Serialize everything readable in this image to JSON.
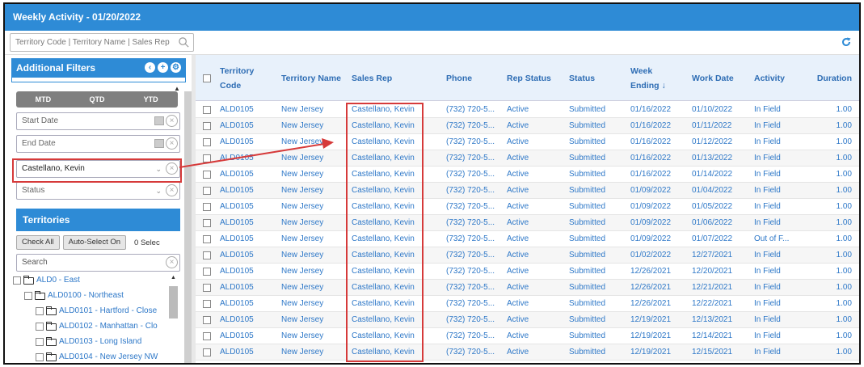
{
  "window": {
    "title": "Weekly Activity - 01/20/2022"
  },
  "toolbar": {
    "search_placeholder": "Territory Code | Territory Name | Sales Rep"
  },
  "filters": {
    "title": "Additional Filters",
    "periods": [
      "MTD",
      "QTD",
      "YTD"
    ],
    "start_date": "Start Date",
    "end_date": "End Date",
    "sales_rep": "Castellano, Kevin",
    "status": "Status"
  },
  "territories": {
    "title": "Territories",
    "check_all": "Check All",
    "auto_select": "Auto-Select On",
    "selected_text": "0 Selec",
    "search_placeholder": "Search",
    "tree": [
      {
        "label": "ALD0 - East",
        "level": 0
      },
      {
        "label": "ALD0100 - Northeast",
        "level": 1
      },
      {
        "label": "ALD0101 - Hartford - Close",
        "level": 2
      },
      {
        "label": "ALD0102 - Manhattan - Clo",
        "level": 2
      },
      {
        "label": "ALD0103 - Long Island",
        "level": 2
      },
      {
        "label": "ALD0104 - New Jersey NW",
        "level": 2
      }
    ]
  },
  "table": {
    "headers": {
      "territory_code": "Territory Code",
      "territory_name": "Territory Name",
      "sales_rep": "Sales Rep",
      "phone": "Phone",
      "rep_status": "Rep Status",
      "status": "Status",
      "week_ending": "Week Ending ↓",
      "work_date": "Work Date",
      "activity": "Activity",
      "duration": "Duration"
    },
    "rows": [
      [
        "ALD0105",
        "New Jersey",
        "Castellano, Kevin",
        "(732) 720-5...",
        "Active",
        "Submitted",
        "01/16/2022",
        "01/10/2022",
        "In Field",
        "1.00"
      ],
      [
        "ALD0105",
        "New Jersey",
        "Castellano, Kevin",
        "(732) 720-5...",
        "Active",
        "Submitted",
        "01/16/2022",
        "01/11/2022",
        "In Field",
        "1.00"
      ],
      [
        "ALD0105",
        "New Jersey",
        "Castellano, Kevin",
        "(732) 720-5...",
        "Active",
        "Submitted",
        "01/16/2022",
        "01/12/2022",
        "In Field",
        "1.00"
      ],
      [
        "ALD0105",
        "New Jersey",
        "Castellano, Kevin",
        "(732) 720-5...",
        "Active",
        "Submitted",
        "01/16/2022",
        "01/13/2022",
        "In Field",
        "1.00"
      ],
      [
        "ALD0105",
        "New Jersey",
        "Castellano, Kevin",
        "(732) 720-5...",
        "Active",
        "Submitted",
        "01/16/2022",
        "01/14/2022",
        "In Field",
        "1.00"
      ],
      [
        "ALD0105",
        "New Jersey",
        "Castellano, Kevin",
        "(732) 720-5...",
        "Active",
        "Submitted",
        "01/09/2022",
        "01/04/2022",
        "In Field",
        "1.00"
      ],
      [
        "ALD0105",
        "New Jersey",
        "Castellano, Kevin",
        "(732) 720-5...",
        "Active",
        "Submitted",
        "01/09/2022",
        "01/05/2022",
        "In Field",
        "1.00"
      ],
      [
        "ALD0105",
        "New Jersey",
        "Castellano, Kevin",
        "(732) 720-5...",
        "Active",
        "Submitted",
        "01/09/2022",
        "01/06/2022",
        "In Field",
        "1.00"
      ],
      [
        "ALD0105",
        "New Jersey",
        "Castellano, Kevin",
        "(732) 720-5...",
        "Active",
        "Submitted",
        "01/09/2022",
        "01/07/2022",
        "Out of F...",
        "1.00"
      ],
      [
        "ALD0105",
        "New Jersey",
        "Castellano, Kevin",
        "(732) 720-5...",
        "Active",
        "Submitted",
        "01/02/2022",
        "12/27/2021",
        "In Field",
        "1.00"
      ],
      [
        "ALD0105",
        "New Jersey",
        "Castellano, Kevin",
        "(732) 720-5...",
        "Active",
        "Submitted",
        "12/26/2021",
        "12/20/2021",
        "In Field",
        "1.00"
      ],
      [
        "ALD0105",
        "New Jersey",
        "Castellano, Kevin",
        "(732) 720-5...",
        "Active",
        "Submitted",
        "12/26/2021",
        "12/21/2021",
        "In Field",
        "1.00"
      ],
      [
        "ALD0105",
        "New Jersey",
        "Castellano, Kevin",
        "(732) 720-5...",
        "Active",
        "Submitted",
        "12/26/2021",
        "12/22/2021",
        "In Field",
        "1.00"
      ],
      [
        "ALD0105",
        "New Jersey",
        "Castellano, Kevin",
        "(732) 720-5...",
        "Active",
        "Submitted",
        "12/19/2021",
        "12/13/2021",
        "In Field",
        "1.00"
      ],
      [
        "ALD0105",
        "New Jersey",
        "Castellano, Kevin",
        "(732) 720-5...",
        "Active",
        "Submitted",
        "12/19/2021",
        "12/14/2021",
        "In Field",
        "1.00"
      ],
      [
        "ALD0105",
        "New Jersey",
        "Castellano, Kevin",
        "(732) 720-5...",
        "Active",
        "Submitted",
        "12/19/2021",
        "12/15/2021",
        "In Field",
        "1.00"
      ]
    ]
  },
  "colors": {
    "accent": "#2e8bd6",
    "highlight": "#d63a3a",
    "link": "#2e78c8"
  }
}
